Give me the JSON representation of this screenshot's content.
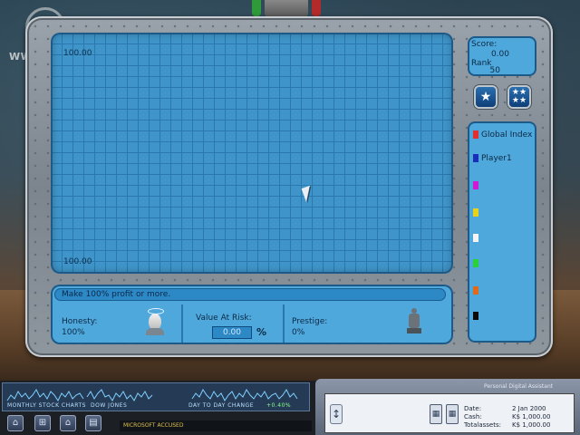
{
  "watermark": "WWW.AG.RU",
  "graph": {
    "top_value": "100.00",
    "bottom_value": "100.00"
  },
  "score_panel": {
    "score_label": "Score:",
    "score_value": "0.00",
    "rank_label": "Rank",
    "rank_value": "50"
  },
  "buttons": {
    "single_star_icon": "star-icon",
    "multi_star_icon": "stars-icon"
  },
  "legend": {
    "items": [
      {
        "label": "Global Index",
        "color": "#e23030"
      },
      {
        "label": "Player1",
        "color": "#1a2fb8"
      },
      {
        "label": "",
        "color": "#d01ad6"
      },
      {
        "label": "",
        "color": "#e8d21a"
      },
      {
        "label": "",
        "color": "#f4f4f4"
      },
      {
        "label": "",
        "color": "#2ad23a"
      },
      {
        "label": "",
        "color": "#e06a1a"
      },
      {
        "label": "",
        "color": "#0a0a0a"
      }
    ]
  },
  "objective": "Make 100% profit or more.",
  "stats": {
    "honesty_label": "Honesty:",
    "honesty_value": "100%",
    "value_at_risk_label": "Value At Risk:",
    "value_at_risk_value": "0.00",
    "value_at_risk_unit": "%",
    "prestige_label": "Prestige:",
    "prestige_value": "0%"
  },
  "taskbar": {
    "labels": [
      "MONTHLY STOCK CHARTS",
      "DOW JONES",
      "DAY TO DAY CHANGE",
      "+0.40%"
    ],
    "news": "MICROSOFT ACCUSED",
    "icons": [
      "home-icon",
      "network-icon",
      "house-icon",
      "document-icon"
    ]
  },
  "pda": {
    "title": "Personal Digital Assistant",
    "date_label": "Date:",
    "date_value": "2 Jan 2000",
    "cash_label": "Cash:",
    "cash_value": "K$ 1,000.00",
    "total_label": "Totalassets:",
    "total_value": "K$ 1,000.00"
  },
  "colors": {
    "panel_blue": "#4fa8dc",
    "grid_blue": "#3f95c9",
    "frame_gray": "#8a939b"
  }
}
